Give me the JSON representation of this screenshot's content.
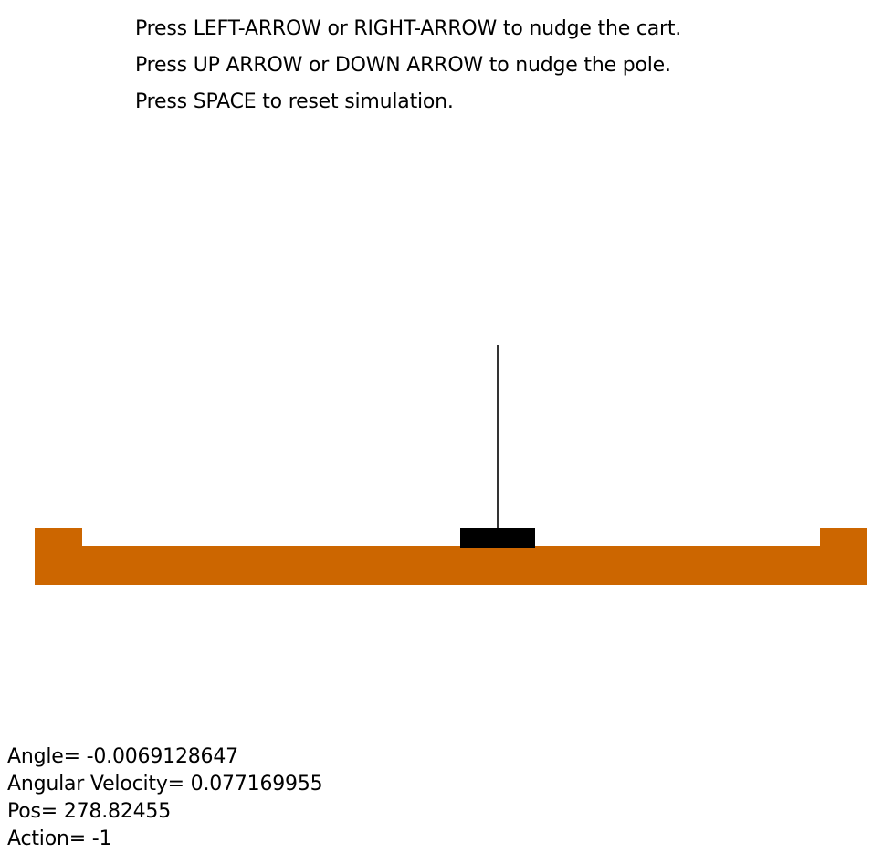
{
  "instructions": [
    "Press LEFT-ARROW or RIGHT-ARROW to nudge the cart.",
    "Press UP ARROW or DOWN ARROW to nudge the pole.",
    "Press SPACE to reset simulation."
  ],
  "colors": {
    "track": "#CC6600",
    "cart": "#000000",
    "pole": "#000000",
    "background": "#FFFFFF"
  },
  "readouts": {
    "angle": "Angle= -0.0069128647",
    "angular_velocity": "Angular Velocity= 0.077169955",
    "position": "Pos= 278.82455",
    "action": "Action= -1"
  }
}
